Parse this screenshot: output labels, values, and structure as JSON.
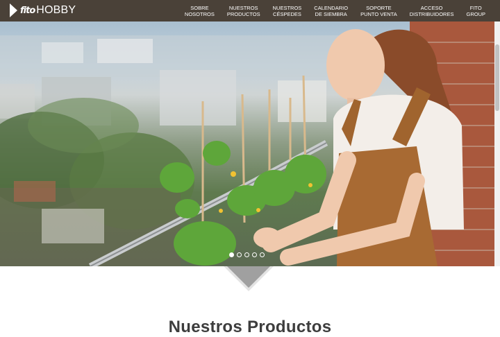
{
  "brand": {
    "mark": "fito",
    "name": "HOBBY"
  },
  "nav": [
    {
      "line1": "SOBRE",
      "line2": "NOSOTROS"
    },
    {
      "line1": "NUESTROS",
      "line2": "PRODUCTOS"
    },
    {
      "line1": "NUESTROS",
      "line2": "CÉSPEDES"
    },
    {
      "line1": "CALENDARIO",
      "line2": "DE SIEMBRA"
    },
    {
      "line1": "SOPORTE",
      "line2": "PUNTO VENTA"
    },
    {
      "line1": "ACCESO",
      "line2": "DISTRIBUIDORES"
    },
    {
      "line1": "FITO",
      "line2": "GROUP"
    }
  ],
  "carousel": {
    "slides": 5,
    "active_index": 0
  },
  "section": {
    "title": "Nuestros Productos"
  },
  "colors": {
    "topbar": "#4a4138",
    "chevron": "#a0a0a0"
  }
}
